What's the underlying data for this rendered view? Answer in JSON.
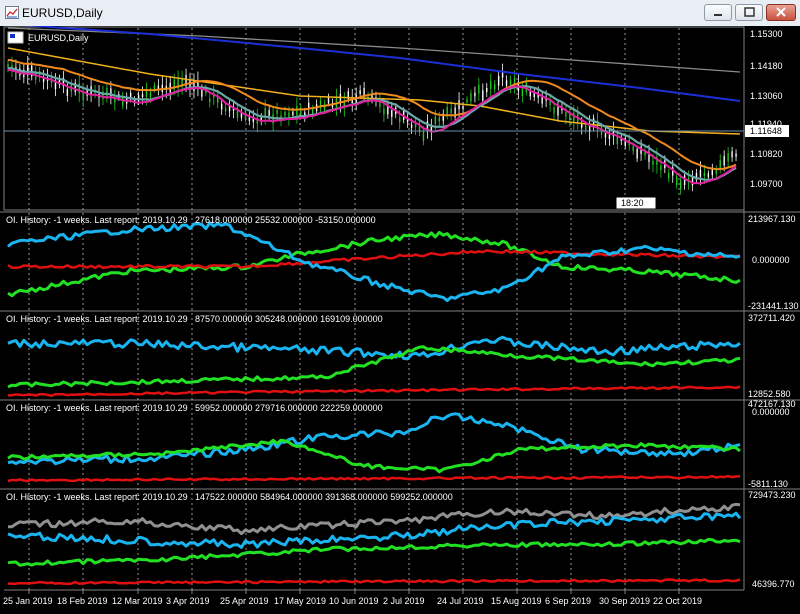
{
  "window": {
    "title": "EURUSD,Daily",
    "minimize_icon": "minimize-icon",
    "maximize_icon": "maximize-icon",
    "close_icon": "close-icon"
  },
  "main_chart": {
    "symbol_label": "EURUSD,Daily",
    "price_ticks": [
      "1.15300",
      "1.14180",
      "1.13060",
      "1.11940",
      "1.10820",
      "1.09700"
    ],
    "current_price": "1.11648",
    "countdown": "18:20",
    "colors": {
      "background": "#000000",
      "grid": "#ffffff",
      "price_line": "#6e8fa8",
      "ma_blue": "#1c2fd6",
      "ma_gray": "#8a8a8a",
      "ma_yellow": "#f2b21c",
      "ma_orange": "#f08a1c",
      "ma_teal": "#6aa7a8",
      "ma_magenta": "#e020a0",
      "bull_candle": "#22cc22",
      "bear_candle": "#ffffff"
    }
  },
  "indicator_panels": [
    {
      "header": "OI. History: -1 weeks. Last report: 2019.10.29",
      "values": "27618.000000 25532.000000 -53150.000000",
      "ticks": [
        "213967.130",
        "0.000000",
        "-231441.130"
      ]
    },
    {
      "header": "OI. History: -1 weeks. Last report: 2019.10.29",
      "values": "87570.000000 305248.000000 169109.000000",
      "ticks": [
        "372711.420",
        "12852.580"
      ]
    },
    {
      "header": "OI. History: -1 weeks. Last report: 2019.10.29",
      "values": "59952.000000 279716.000000 222259.000000",
      "ticks": [
        "472167.130",
        "0.000000",
        "-5811.130"
      ]
    },
    {
      "header": "OI. History: -1 weeks. Last report: 2019.10.29",
      "values": "147522.000000 584964.000000 391368.000000 599252.000000",
      "ticks": [
        "729473.230",
        "46396.770"
      ]
    }
  ],
  "series_colors": {
    "blue": "#1ab4f0",
    "green": "#22e022",
    "red": "#e01010",
    "gray": "#909090"
  },
  "date_axis": [
    "25 Jan 2019",
    "18 Feb 2019",
    "12 Mar 2019",
    "3 Apr 2019",
    "25 Apr 2019",
    "17 May 2019",
    "10 Jun 2019",
    "2 Jul 2019",
    "24 Jul 2019",
    "15 Aug 2019",
    "6 Sep 2019",
    "30 Sep 2019",
    "22 Oct 2019"
  ]
}
